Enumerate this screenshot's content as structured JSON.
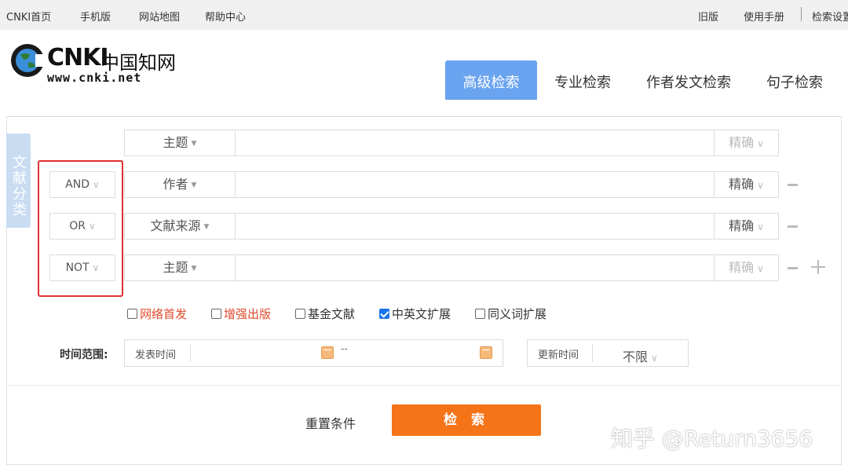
{
  "topbar": {
    "left_links": [
      "CNKI首页",
      "手机版",
      "网站地图",
      "帮助中心"
    ],
    "right_links": [
      "旧版",
      "使用手册",
      "检索设置"
    ]
  },
  "logo": {
    "brand": "CNKI",
    "cn_name": "中国知网",
    "url": "www.cnki.net"
  },
  "tabs": [
    "高级检索",
    "专业检索",
    "作者发文检索",
    "句子检索"
  ],
  "active_tab": "高级检索",
  "side_tab": "文献分类",
  "rows": [
    {
      "logic": "",
      "field": "主题",
      "match": "精确",
      "match_dim": true
    },
    {
      "logic": "AND",
      "field": "作者",
      "match": "精确",
      "match_dim": false
    },
    {
      "logic": "OR",
      "field": "文献来源",
      "match": "精确",
      "match_dim": false
    },
    {
      "logic": "NOT",
      "field": "主题",
      "match": "精确",
      "match_dim": true
    }
  ],
  "options": [
    {
      "label": "网络首发",
      "checked": false,
      "highlight": true
    },
    {
      "label": "增强出版",
      "checked": false,
      "highlight": true
    },
    {
      "label": "基金文献",
      "checked": false,
      "highlight": false
    },
    {
      "label": "中英文扩展",
      "checked": true,
      "highlight": false
    },
    {
      "label": "同义词扩展",
      "checked": false,
      "highlight": false
    }
  ],
  "time": {
    "label": "时间范围:",
    "publish_label": "发表时间",
    "range_separator": "--",
    "update_label": "更新时间",
    "update_value": "不限"
  },
  "actions": {
    "reset": "重置条件",
    "search": "检 索"
  },
  "watermark": "知乎 @Return3656",
  "colors": {
    "active_tab": "#6aa3f0",
    "search_button": "#f57418",
    "highlight_text": "#e04a2b",
    "annotation_box": "#e03030"
  }
}
